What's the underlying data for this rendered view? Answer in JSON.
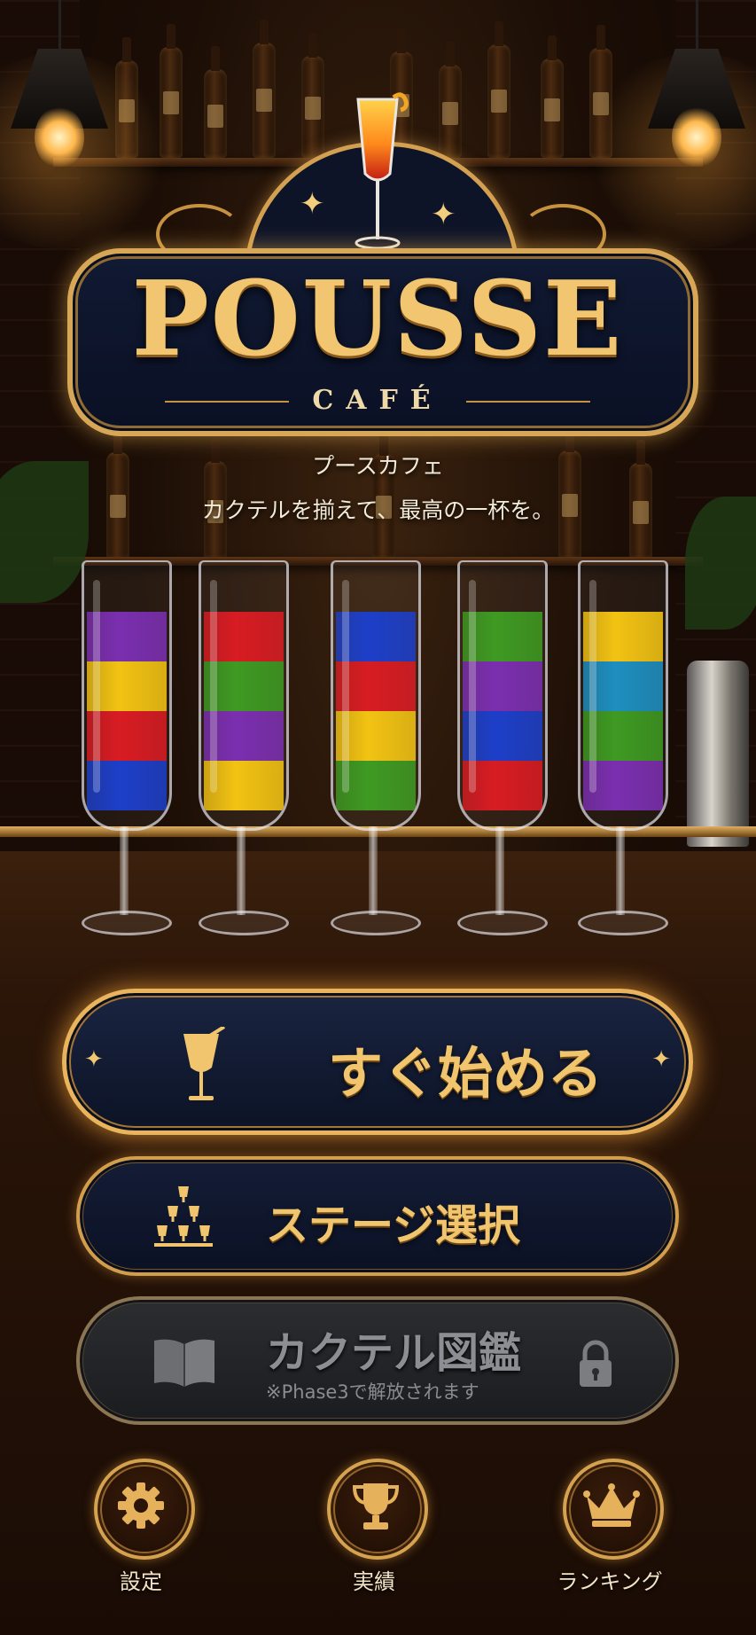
{
  "logo": {
    "title": "POUSSE",
    "subtitle": "CAFÉ"
  },
  "tagline": {
    "line1": "プースカフェ",
    "line2": "カクテルを揃えて、最高の一杯を。"
  },
  "glasses": [
    {
      "layers": [
        "#7b2fb0",
        "#f2c313",
        "#d81c23",
        "#1d3fc9"
      ]
    },
    {
      "layers": [
        "#d81c23",
        "#3e9a22",
        "#7b2fb0",
        "#f2c313"
      ]
    },
    {
      "layers": [
        "#1d3fc9",
        "#d81c23",
        "#f2c313",
        "#3e9a22"
      ]
    },
    {
      "layers": [
        "#3e9a22",
        "#7b2fb0",
        "#1d3fc9",
        "#d81c23"
      ]
    },
    {
      "layers": [
        "#f2c313",
        "#1e8fc0",
        "#3e9a22",
        "#7b2fb0"
      ]
    }
  ],
  "buttons": {
    "quick_start": {
      "label": "すぐ始める",
      "icon": "cocktail-glass-icon"
    },
    "stage_select": {
      "label": "ステージ選択",
      "icon": "glass-pyramid-icon"
    },
    "encyclopedia": {
      "label": "カクテル図鑑",
      "note": "※Phase3で解放されます",
      "icon": "book-icon",
      "locked": true
    }
  },
  "nav": [
    {
      "label": "設定",
      "icon": "gear-icon"
    },
    {
      "label": "実績",
      "icon": "trophy-icon"
    },
    {
      "label": "ランキング",
      "icon": "crown-icon"
    }
  ],
  "colors": {
    "gold": "#f1c56d",
    "navy": "#0c1326",
    "locked_gray": "#8d8e93"
  }
}
